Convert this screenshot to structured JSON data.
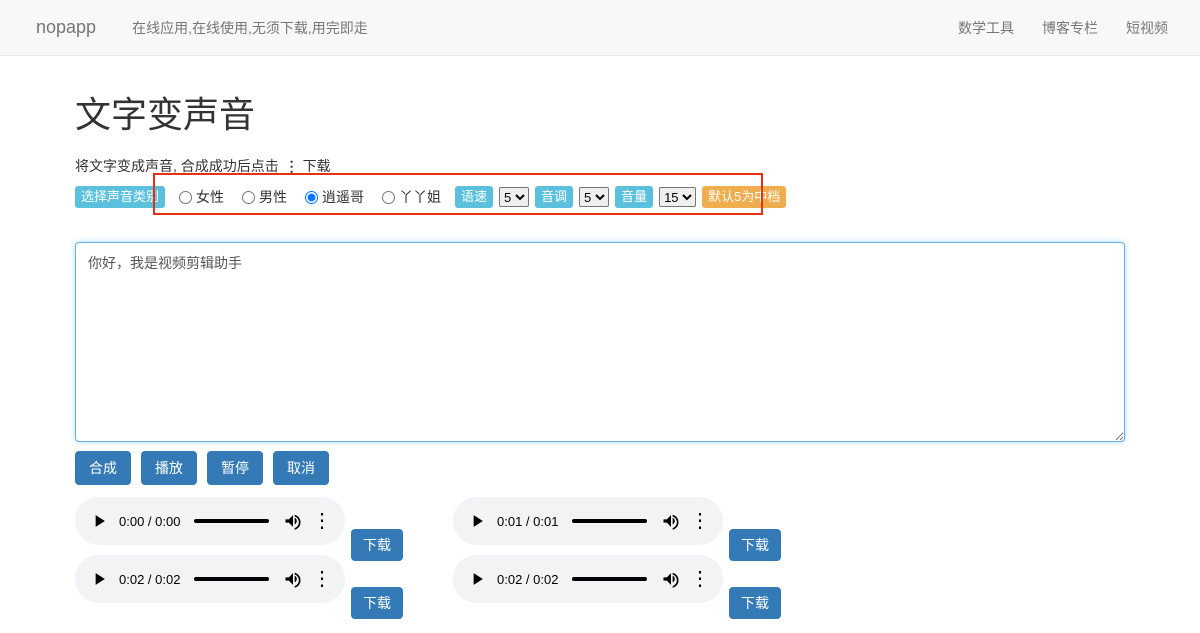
{
  "nav": {
    "brand": "nopapp",
    "tagline": "在线应用,在线使用,无须下载,用完即走",
    "links": [
      "数学工具",
      "博客专栏",
      "短视频"
    ]
  },
  "page": {
    "title": "文字变声音",
    "subtitle_before": "将文字变成声音, 合成成功后点击",
    "subtitle_after": "下载"
  },
  "options": {
    "type_label": "选择声音类别",
    "voices": [
      {
        "label": "女性",
        "checked": false
      },
      {
        "label": "男性",
        "checked": false
      },
      {
        "label": "逍遥哥",
        "checked": true
      },
      {
        "label": "丫丫姐",
        "checked": false
      }
    ],
    "speed_label": "语速",
    "speed_value": "5",
    "pitch_label": "音调",
    "pitch_value": "5",
    "volume_label": "音量",
    "volume_value": "15",
    "default_note": "默认5为中档"
  },
  "textarea": {
    "value": "你好，我是视频剪辑助手"
  },
  "buttons": {
    "synthesize": "合成",
    "play": "播放",
    "pause": "暂停",
    "cancel": "取消",
    "download": "下载"
  },
  "audios": [
    {
      "time": "0:00 / 0:00"
    },
    {
      "time": "0:01 / 0:01"
    },
    {
      "time": "0:02 / 0:02"
    },
    {
      "time": "0:02 / 0:02"
    }
  ]
}
